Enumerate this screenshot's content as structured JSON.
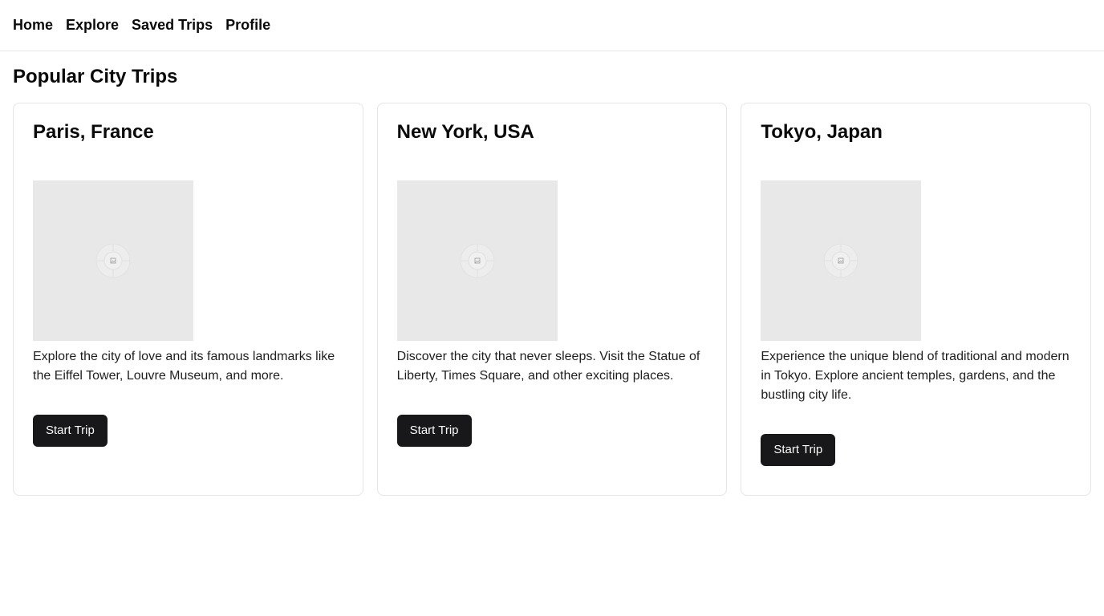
{
  "nav": {
    "items": [
      {
        "label": "Home"
      },
      {
        "label": "Explore"
      },
      {
        "label": "Saved Trips"
      },
      {
        "label": "Profile"
      }
    ]
  },
  "main": {
    "title": "Popular City Trips",
    "cards": [
      {
        "title": "Paris, France",
        "image_icon": "image-placeholder-icon",
        "description": "Explore the city of love and its famous landmarks like the Eiffel Tower, Louvre Museum, and more.",
        "button_label": "Start Trip"
      },
      {
        "title": "New York, USA",
        "image_icon": "image-placeholder-icon",
        "description": "Discover the city that never sleeps. Visit the Statue of Liberty, Times Square, and other exciting places.",
        "button_label": "Start Trip"
      },
      {
        "title": "Tokyo, Japan",
        "image_icon": "image-placeholder-icon",
        "description": "Experience the unique blend of traditional and modern in Tokyo. Explore ancient temples, gardens, and the bustling city life.",
        "button_label": "Start Trip"
      }
    ]
  },
  "colors": {
    "button_bg": "#18181b",
    "button_text": "#fafafa",
    "border": "#e5e5e5",
    "placeholder_bg": "#e8e8e8"
  }
}
